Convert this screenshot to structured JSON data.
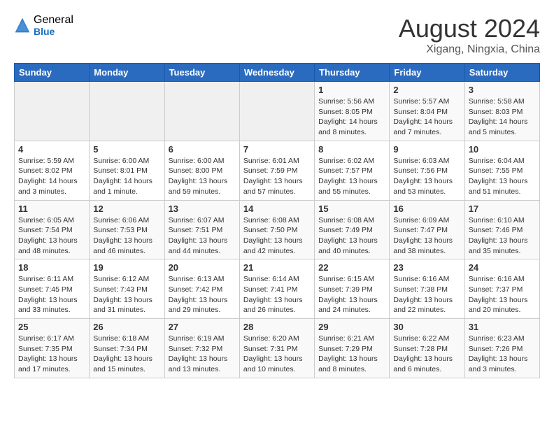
{
  "header": {
    "logo_general": "General",
    "logo_blue": "Blue",
    "month_title": "August 2024",
    "location": "Xigang, Ningxia, China"
  },
  "weekdays": [
    "Sunday",
    "Monday",
    "Tuesday",
    "Wednesday",
    "Thursday",
    "Friday",
    "Saturday"
  ],
  "weeks": [
    [
      {
        "day": "",
        "info": ""
      },
      {
        "day": "",
        "info": ""
      },
      {
        "day": "",
        "info": ""
      },
      {
        "day": "",
        "info": ""
      },
      {
        "day": "1",
        "info": "Sunrise: 5:56 AM\nSunset: 8:05 PM\nDaylight: 14 hours\nand 8 minutes."
      },
      {
        "day": "2",
        "info": "Sunrise: 5:57 AM\nSunset: 8:04 PM\nDaylight: 14 hours\nand 7 minutes."
      },
      {
        "day": "3",
        "info": "Sunrise: 5:58 AM\nSunset: 8:03 PM\nDaylight: 14 hours\nand 5 minutes."
      }
    ],
    [
      {
        "day": "4",
        "info": "Sunrise: 5:59 AM\nSunset: 8:02 PM\nDaylight: 14 hours\nand 3 minutes."
      },
      {
        "day": "5",
        "info": "Sunrise: 6:00 AM\nSunset: 8:01 PM\nDaylight: 14 hours\nand 1 minute."
      },
      {
        "day": "6",
        "info": "Sunrise: 6:00 AM\nSunset: 8:00 PM\nDaylight: 13 hours\nand 59 minutes."
      },
      {
        "day": "7",
        "info": "Sunrise: 6:01 AM\nSunset: 7:59 PM\nDaylight: 13 hours\nand 57 minutes."
      },
      {
        "day": "8",
        "info": "Sunrise: 6:02 AM\nSunset: 7:57 PM\nDaylight: 13 hours\nand 55 minutes."
      },
      {
        "day": "9",
        "info": "Sunrise: 6:03 AM\nSunset: 7:56 PM\nDaylight: 13 hours\nand 53 minutes."
      },
      {
        "day": "10",
        "info": "Sunrise: 6:04 AM\nSunset: 7:55 PM\nDaylight: 13 hours\nand 51 minutes."
      }
    ],
    [
      {
        "day": "11",
        "info": "Sunrise: 6:05 AM\nSunset: 7:54 PM\nDaylight: 13 hours\nand 48 minutes."
      },
      {
        "day": "12",
        "info": "Sunrise: 6:06 AM\nSunset: 7:53 PM\nDaylight: 13 hours\nand 46 minutes."
      },
      {
        "day": "13",
        "info": "Sunrise: 6:07 AM\nSunset: 7:51 PM\nDaylight: 13 hours\nand 44 minutes."
      },
      {
        "day": "14",
        "info": "Sunrise: 6:08 AM\nSunset: 7:50 PM\nDaylight: 13 hours\nand 42 minutes."
      },
      {
        "day": "15",
        "info": "Sunrise: 6:08 AM\nSunset: 7:49 PM\nDaylight: 13 hours\nand 40 minutes."
      },
      {
        "day": "16",
        "info": "Sunrise: 6:09 AM\nSunset: 7:47 PM\nDaylight: 13 hours\nand 38 minutes."
      },
      {
        "day": "17",
        "info": "Sunrise: 6:10 AM\nSunset: 7:46 PM\nDaylight: 13 hours\nand 35 minutes."
      }
    ],
    [
      {
        "day": "18",
        "info": "Sunrise: 6:11 AM\nSunset: 7:45 PM\nDaylight: 13 hours\nand 33 minutes."
      },
      {
        "day": "19",
        "info": "Sunrise: 6:12 AM\nSunset: 7:43 PM\nDaylight: 13 hours\nand 31 minutes."
      },
      {
        "day": "20",
        "info": "Sunrise: 6:13 AM\nSunset: 7:42 PM\nDaylight: 13 hours\nand 29 minutes."
      },
      {
        "day": "21",
        "info": "Sunrise: 6:14 AM\nSunset: 7:41 PM\nDaylight: 13 hours\nand 26 minutes."
      },
      {
        "day": "22",
        "info": "Sunrise: 6:15 AM\nSunset: 7:39 PM\nDaylight: 13 hours\nand 24 minutes."
      },
      {
        "day": "23",
        "info": "Sunrise: 6:16 AM\nSunset: 7:38 PM\nDaylight: 13 hours\nand 22 minutes."
      },
      {
        "day": "24",
        "info": "Sunrise: 6:16 AM\nSunset: 7:37 PM\nDaylight: 13 hours\nand 20 minutes."
      }
    ],
    [
      {
        "day": "25",
        "info": "Sunrise: 6:17 AM\nSunset: 7:35 PM\nDaylight: 13 hours\nand 17 minutes."
      },
      {
        "day": "26",
        "info": "Sunrise: 6:18 AM\nSunset: 7:34 PM\nDaylight: 13 hours\nand 15 minutes."
      },
      {
        "day": "27",
        "info": "Sunrise: 6:19 AM\nSunset: 7:32 PM\nDaylight: 13 hours\nand 13 minutes."
      },
      {
        "day": "28",
        "info": "Sunrise: 6:20 AM\nSunset: 7:31 PM\nDaylight: 13 hours\nand 10 minutes."
      },
      {
        "day": "29",
        "info": "Sunrise: 6:21 AM\nSunset: 7:29 PM\nDaylight: 13 hours\nand 8 minutes."
      },
      {
        "day": "30",
        "info": "Sunrise: 6:22 AM\nSunset: 7:28 PM\nDaylight: 13 hours\nand 6 minutes."
      },
      {
        "day": "31",
        "info": "Sunrise: 6:23 AM\nSunset: 7:26 PM\nDaylight: 13 hours\nand 3 minutes."
      }
    ]
  ]
}
